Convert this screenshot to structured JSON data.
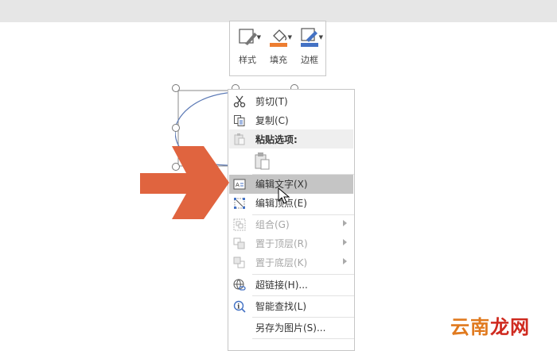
{
  "colors": {
    "accent_arrow": "#e0643f",
    "fill_orange": "#ed7d31",
    "border_blue": "#4472c4",
    "hover_gray": "#c5c5c5"
  },
  "mini_toolbar": {
    "style_label": "样式",
    "fill_label": "填充",
    "border_label": "边框"
  },
  "context_menu": {
    "cut": "剪切(T)",
    "copy": "复制(C)",
    "paste_options": "粘贴选项:",
    "edit_text": "编辑文字(X)",
    "edit_points": "编辑顶点(E)",
    "group": "组合(G)",
    "bring_front": "置于顶层(R)",
    "send_back": "置于底层(K)",
    "hyperlink": "超链接(H)...",
    "smart_lookup": "智能查找(L)",
    "save_as_picture": "另存为图片(S)..."
  },
  "watermark": {
    "part1": "云南",
    "part2": "龙网"
  }
}
